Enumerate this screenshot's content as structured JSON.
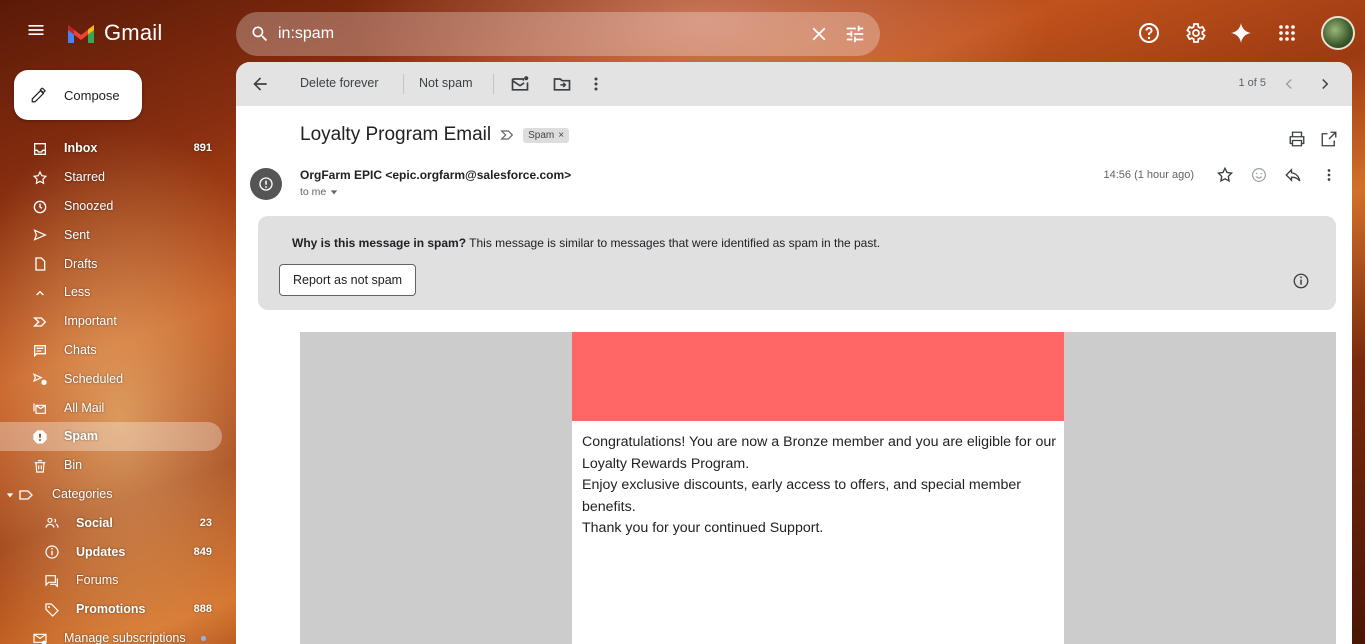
{
  "app": {
    "name": "Gmail"
  },
  "search": {
    "query": "in:spam"
  },
  "sidebar": {
    "compose_label": "Compose",
    "items": [
      {
        "label": "Inbox",
        "count": "891",
        "icon": "inbox-icon",
        "bold": true
      },
      {
        "label": "Starred",
        "count": "",
        "icon": "star-icon"
      },
      {
        "label": "Snoozed",
        "count": "",
        "icon": "clock-icon"
      },
      {
        "label": "Sent",
        "count": "",
        "icon": "send-icon"
      },
      {
        "label": "Drafts",
        "count": "",
        "icon": "draft-icon"
      },
      {
        "label": "Less",
        "count": "",
        "icon": "chevron-up-icon"
      },
      {
        "label": "Important",
        "count": "",
        "icon": "important-icon"
      },
      {
        "label": "Chats",
        "count": "",
        "icon": "chat-icon"
      },
      {
        "label": "Scheduled",
        "count": "",
        "icon": "scheduled-icon"
      },
      {
        "label": "All Mail",
        "count": "",
        "icon": "all-mail-icon"
      },
      {
        "label": "Spam",
        "count": "",
        "icon": "spam-icon",
        "active": true,
        "bold": true
      },
      {
        "label": "Bin",
        "count": "",
        "icon": "trash-icon"
      },
      {
        "label": "Categories",
        "count": "",
        "icon": "label-icon"
      },
      {
        "label": "Social",
        "count": "23",
        "icon": "people-icon",
        "bold": true
      },
      {
        "label": "Updates",
        "count": "849",
        "icon": "info-icon",
        "bold": true
      },
      {
        "label": "Forums",
        "count": "",
        "icon": "forum-icon"
      },
      {
        "label": "Promotions",
        "count": "888",
        "icon": "tag-icon",
        "bold": true
      },
      {
        "label": "Manage subscriptions",
        "count": "",
        "icon": "manage-subscriptions-icon"
      }
    ]
  },
  "toolbar": {
    "delete_forever": "Delete forever",
    "not_spam": "Not spam",
    "pager": "1 of 5"
  },
  "message": {
    "subject": "Loyalty Program Email",
    "label": "Spam",
    "label_remove": "×",
    "sender": "OrgFarm EPIC <epic.orgfarm@salesforce.com>",
    "to": "to me",
    "time": "14:56 (1 hour ago)",
    "avatar_letter": "!"
  },
  "spam_notice": {
    "title": "Why is this message in spam?",
    "text": " This message is similar to messages that were identified as spam in the past.",
    "button": "Report as not spam"
  },
  "email_body": {
    "banner_color": "#ff6666",
    "line1": "Congratulations! You are now a Bronze member and you are eligible for our Loyalty Rewards Program.",
    "line2": "Enjoy exclusive discounts, early access to offers, and special member benefits.",
    "line3": "Thank you for your continued Support."
  }
}
